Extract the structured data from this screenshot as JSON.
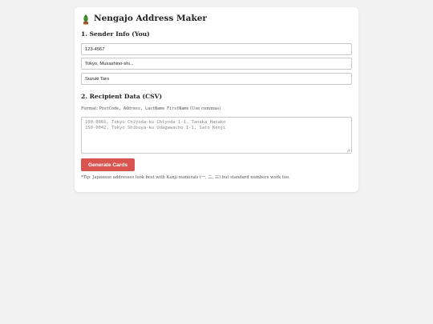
{
  "header": {
    "icon": "pine-tree-icon",
    "title": "Nengajo Address Maker"
  },
  "sender": {
    "section_title": "1. Sender Info (You)",
    "postcode": "123-4567",
    "address": "Tokyo, Musashino-shi...",
    "name": "Suzuki Taro"
  },
  "recipients": {
    "section_title": "2. Recipient Data (CSV)",
    "format_prefix": "Format: ",
    "format_fields": "PostCode, Address, LastName FirstName",
    "format_suffix": " (Use commas)",
    "placeholder_lines": [
      "100-0001, Tokyo Chiyoda-ku Chiyoda 1-1, Tanaka Hanako",
      "150-0042, Tokyo Shibuya-ku Udagawacho 1-1, Sato Kenji"
    ]
  },
  "actions": {
    "generate_label": "Generate Cards"
  },
  "tip": "*Tip: Japanese addresses look best with Kanji numerals (一, 二, 三) but standard numbers work too.",
  "colors": {
    "accent": "#d9534f",
    "background": "#f2f2f2",
    "card": "#ffffff"
  }
}
